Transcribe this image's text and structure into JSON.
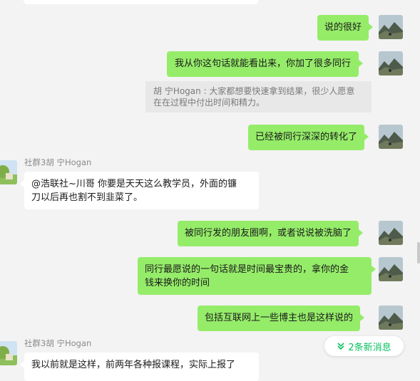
{
  "messages": [
    {
      "text": "说的很好"
    },
    {
      "text": "我从你这句话就能看出来，你加了很多同行"
    },
    {
      "quote": "胡 宁Hogan : 大家都想要快速拿到结果，很少人愿意在在过程中付出时间和精力。"
    },
    {
      "text": "已经被同行深深的转化了"
    },
    {
      "sender": "社群3胡 宁Hogan",
      "text_line1": "@浩联社~川哥 你要是天天这么教学员，外面的镰",
      "text_line2": "刀以后再也割不到韭菜了。"
    },
    {
      "text": "被同行发的朋友圈啊，或者说说被洗脑了"
    },
    {
      "text_line1": "同行最愿说的一句话就是时间最宝贵的，拿你的金",
      "text_line2": "钱来换你的时间"
    },
    {
      "text": "包括互联网上一些博主也是这样说的"
    },
    {
      "sender": "社群3胡 宁Hogan",
      "text": "我以前就是这样，前两年各种报课程，实际上报了"
    }
  ],
  "new_messages": {
    "label": "2条新消息",
    "icon": "double-chevron-down-icon"
  },
  "colors": {
    "outgoing": "#95ec69",
    "incoming": "#ffffff",
    "accent": "#07c160",
    "background": "#f3f3f3"
  }
}
